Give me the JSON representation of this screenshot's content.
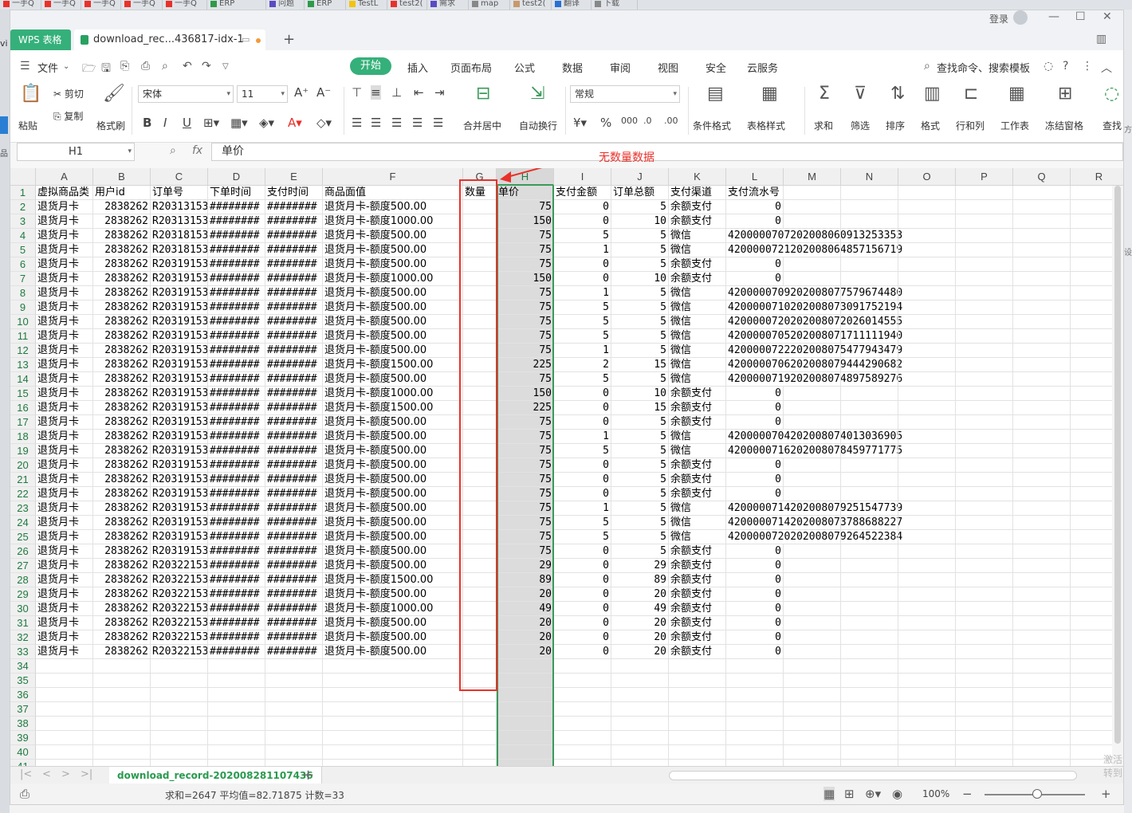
{
  "browser_tabs": [
    {
      "label": "一手Q",
      "color": "#e8312a"
    },
    {
      "label": "一手Q",
      "color": "#e8312a"
    },
    {
      "label": "一手Q",
      "color": "#e8312a"
    },
    {
      "label": "一手Q",
      "color": "#e8312a"
    },
    {
      "label": "一手Q",
      "color": "#e8312a"
    },
    {
      "label": "ERP",
      "color": "#2e9a4a"
    },
    {
      "label": "问题",
      "color": "#5a4bc4"
    },
    {
      "label": "ERP",
      "color": "#2e9a4a"
    },
    {
      "label": "TestL",
      "color": "#f1c40f"
    },
    {
      "label": "test2(",
      "color": "#e8312a"
    },
    {
      "label": "需求",
      "color": "#5a4bc4"
    },
    {
      "label": "map",
      "color": "#888888"
    },
    {
      "label": "test2(",
      "color": "#c69a6d"
    },
    {
      "label": "翻译",
      "color": "#2a6fd4"
    },
    {
      "label": "下载",
      "color": "#888888"
    }
  ],
  "left_strip": {
    "vis": "vi",
    "pin_label": "品"
  },
  "right_strip": {
    "t1": "设",
    "t2": "方",
    "t3": "激活",
    "t4": "转到"
  },
  "titlebar": {
    "app_tab": "WPS 表格",
    "doc_tab": "download_rec...436817-idx-1",
    "new_tab": "+",
    "login": "登录"
  },
  "menu": {
    "file": "文件",
    "items": [
      "开始",
      "插入",
      "页面布局",
      "公式",
      "数据",
      "审阅",
      "视图",
      "安全",
      "云服务"
    ],
    "search": "查找命令、搜索模板"
  },
  "toolbar": {
    "paste": "粘贴",
    "cut": "剪切",
    "copy": "复制",
    "format_painter": "格式刷",
    "font_name": "宋体",
    "font_size": "11",
    "merge_center": "合并居中",
    "wrap": "自动换行",
    "number_format": "常规",
    "cond_format": "条件格式",
    "table_style": "表格样式",
    "sum": "求和",
    "filter": "筛选",
    "sort": "排序",
    "format": "格式",
    "rowcol": "行和列",
    "sheet": "工作表",
    "freeze": "冻结窗格",
    "find": "查找"
  },
  "formula_bar": {
    "name_box": "H1",
    "fx": "fx",
    "value": "单价"
  },
  "annotation": "无数量数据",
  "columns": [
    "A",
    "B",
    "C",
    "D",
    "E",
    "F",
    "G",
    "H",
    "I",
    "J",
    "K",
    "L",
    "M",
    "N",
    "O",
    "P",
    "Q",
    "R"
  ],
  "header_row": [
    "虚拟商品类",
    "用户id",
    "订单号",
    "下单时间",
    "支付时间",
    "商品面值",
    "数量",
    "单价",
    "支付金额",
    "订单总额",
    "支付渠道",
    "支付流水号"
  ],
  "rows": [
    [
      "退货月卡",
      "2838262",
      "R20313153",
      "########",
      "########",
      "退货月卡-额度500.00",
      "",
      "75",
      "0",
      "5",
      "余额支付",
      "0"
    ],
    [
      "退货月卡",
      "2838262",
      "R20313153",
      "########",
      "########",
      "退货月卡-额度1000.00",
      "",
      "150",
      "0",
      "10",
      "余额支付",
      "0"
    ],
    [
      "退货月卡",
      "2838262",
      "R20318153",
      "########",
      "########",
      "退货月卡-额度500.00",
      "",
      "75",
      "5",
      "5",
      "微信",
      "4200000707202008060913253353"
    ],
    [
      "退货月卡",
      "2838262",
      "R20318153",
      "########",
      "########",
      "退货月卡-额度500.00",
      "",
      "75",
      "1",
      "5",
      "微信",
      "4200000721202008064857156719"
    ],
    [
      "退货月卡",
      "2838262",
      "R20319153",
      "########",
      "########",
      "退货月卡-额度500.00",
      "",
      "75",
      "0",
      "5",
      "余额支付",
      "0"
    ],
    [
      "退货月卡",
      "2838262",
      "R20319153",
      "########",
      "########",
      "退货月卡-额度1000.00",
      "",
      "150",
      "0",
      "10",
      "余额支付",
      "0"
    ],
    [
      "退货月卡",
      "2838262",
      "R20319153",
      "########",
      "########",
      "退货月卡-额度500.00",
      "",
      "75",
      "1",
      "5",
      "微信",
      "4200000709202008077579674480"
    ],
    [
      "退货月卡",
      "2838262",
      "R20319153",
      "########",
      "########",
      "退货月卡-额度500.00",
      "",
      "75",
      "5",
      "5",
      "微信",
      "4200000710202008073091752194"
    ],
    [
      "退货月卡",
      "2838262",
      "R20319153",
      "########",
      "########",
      "退货月卡-额度500.00",
      "",
      "75",
      "5",
      "5",
      "微信",
      "4200000720202008072026014555"
    ],
    [
      "退货月卡",
      "2838262",
      "R20319153",
      "########",
      "########",
      "退货月卡-额度500.00",
      "",
      "75",
      "5",
      "5",
      "微信",
      "4200000705202008071711111940"
    ],
    [
      "退货月卡",
      "2838262",
      "R20319153",
      "########",
      "########",
      "退货月卡-额度500.00",
      "",
      "75",
      "1",
      "5",
      "微信",
      "4200000722202008075477943479"
    ],
    [
      "退货月卡",
      "2838262",
      "R20319153",
      "########",
      "########",
      "退货月卡-额度1500.00",
      "",
      "225",
      "2",
      "15",
      "微信",
      "4200000706202008079444290682"
    ],
    [
      "退货月卡",
      "2838262",
      "R20319153",
      "########",
      "########",
      "退货月卡-额度500.00",
      "",
      "75",
      "5",
      "5",
      "微信",
      "4200000719202008074897589276"
    ],
    [
      "退货月卡",
      "2838262",
      "R20319153",
      "########",
      "########",
      "退货月卡-额度1000.00",
      "",
      "150",
      "0",
      "10",
      "余额支付",
      "0"
    ],
    [
      "退货月卡",
      "2838262",
      "R20319153",
      "########",
      "########",
      "退货月卡-额度1500.00",
      "",
      "225",
      "0",
      "15",
      "余额支付",
      "0"
    ],
    [
      "退货月卡",
      "2838262",
      "R20319153",
      "########",
      "########",
      "退货月卡-额度500.00",
      "",
      "75",
      "0",
      "5",
      "余额支付",
      "0"
    ],
    [
      "退货月卡",
      "2838262",
      "R20319153",
      "########",
      "########",
      "退货月卡-额度500.00",
      "",
      "75",
      "1",
      "5",
      "微信",
      "4200000704202008074013036905"
    ],
    [
      "退货月卡",
      "2838262",
      "R20319153",
      "########",
      "########",
      "退货月卡-额度500.00",
      "",
      "75",
      "5",
      "5",
      "微信",
      "4200000716202008078459771775"
    ],
    [
      "退货月卡",
      "2838262",
      "R20319153",
      "########",
      "########",
      "退货月卡-额度500.00",
      "",
      "75",
      "0",
      "5",
      "余额支付",
      "0"
    ],
    [
      "退货月卡",
      "2838262",
      "R20319153",
      "########",
      "########",
      "退货月卡-额度500.00",
      "",
      "75",
      "0",
      "5",
      "余额支付",
      "0"
    ],
    [
      "退货月卡",
      "2838262",
      "R20319153",
      "########",
      "########",
      "退货月卡-额度500.00",
      "",
      "75",
      "0",
      "5",
      "余额支付",
      "0"
    ],
    [
      "退货月卡",
      "2838262",
      "R20319153",
      "########",
      "########",
      "退货月卡-额度500.00",
      "",
      "75",
      "1",
      "5",
      "微信",
      "4200000714202008079251547739"
    ],
    [
      "退货月卡",
      "2838262",
      "R20319153",
      "########",
      "########",
      "退货月卡-额度500.00",
      "",
      "75",
      "5",
      "5",
      "微信",
      "4200000714202008073788688227"
    ],
    [
      "退货月卡",
      "2838262",
      "R20319153",
      "########",
      "########",
      "退货月卡-额度500.00",
      "",
      "75",
      "5",
      "5",
      "微信",
      "4200000720202008079264522384"
    ],
    [
      "退货月卡",
      "2838262",
      "R20319153",
      "########",
      "########",
      "退货月卡-额度500.00",
      "",
      "75",
      "0",
      "5",
      "余额支付",
      "0"
    ],
    [
      "退货月卡",
      "2838262",
      "R20322153",
      "########",
      "########",
      "退货月卡-额度500.00",
      "",
      "29",
      "0",
      "29",
      "余额支付",
      "0"
    ],
    [
      "退货月卡",
      "2838262",
      "R20322153",
      "########",
      "########",
      "退货月卡-额度1500.00",
      "",
      "89",
      "0",
      "89",
      "余额支付",
      "0"
    ],
    [
      "退货月卡",
      "2838262",
      "R20322153",
      "########",
      "########",
      "退货月卡-额度500.00",
      "",
      "20",
      "0",
      "20",
      "余额支付",
      "0"
    ],
    [
      "退货月卡",
      "2838262",
      "R20322153",
      "########",
      "########",
      "退货月卡-额度1000.00",
      "",
      "49",
      "0",
      "49",
      "余额支付",
      "0"
    ],
    [
      "退货月卡",
      "2838262",
      "R20322153",
      "########",
      "########",
      "退货月卡-额度500.00",
      "",
      "20",
      "0",
      "20",
      "余额支付",
      "0"
    ],
    [
      "退货月卡",
      "2838262",
      "R20322153",
      "########",
      "########",
      "退货月卡-额度500.00",
      "",
      "20",
      "0",
      "20",
      "余额支付",
      "0"
    ],
    [
      "退货月卡",
      "2838262",
      "R20322153",
      "########",
      "########",
      "退货月卡-额度500.00",
      "",
      "20",
      "0",
      "20",
      "余额支付",
      "0"
    ]
  ],
  "row_numbers": [
    "1",
    "2",
    "3",
    "4",
    "5",
    "6",
    "7",
    "8",
    "9",
    "10",
    "11",
    "12",
    "13",
    "14",
    "15",
    "16",
    "17",
    "18",
    "19",
    "20",
    "21",
    "22",
    "23",
    "24",
    "25",
    "26",
    "27",
    "28",
    "29",
    "30",
    "31",
    "32",
    "33",
    "34",
    "35",
    "36",
    "37",
    "38",
    "39",
    "40",
    "41"
  ],
  "sheet_tab": "download_record-202008281107436",
  "status": {
    "summary": "求和=2647  平均值=82.71875  计数=33",
    "zoom": "100%"
  }
}
